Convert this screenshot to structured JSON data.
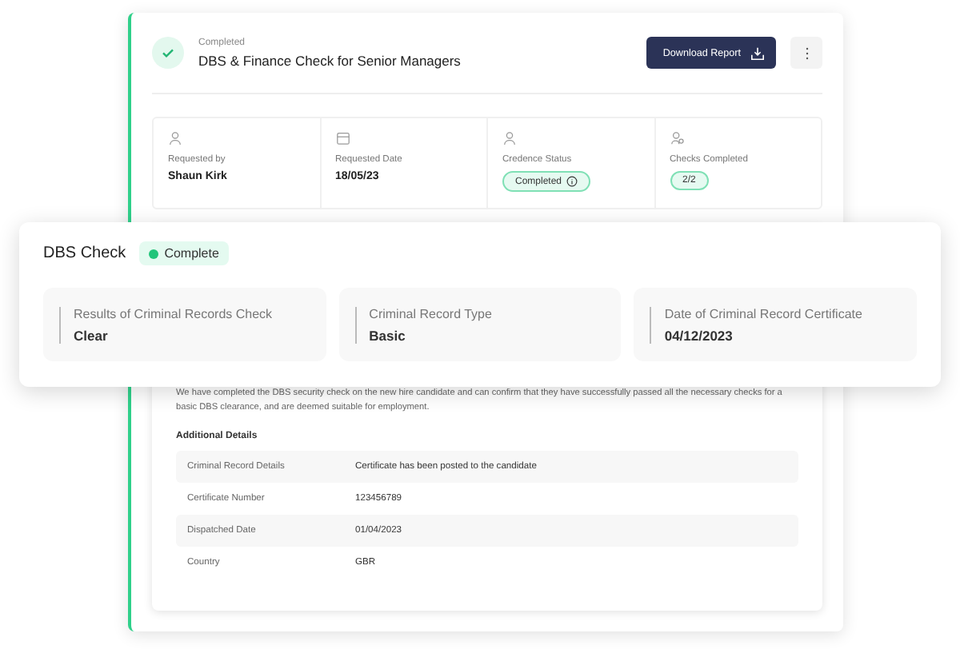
{
  "header": {
    "status": "Completed",
    "title": "DBS & Finance Check for Senior Managers",
    "download_button": "Download Report",
    "completed": true
  },
  "stats": [
    {
      "kind": "text",
      "label": "Requested by",
      "value": "Shaun Kirk"
    },
    {
      "kind": "text",
      "label": "Requested Date",
      "value": "18/05/23"
    },
    {
      "kind": "pill",
      "label": "Credence Status",
      "value": "Completed",
      "info": true
    },
    {
      "kind": "pill",
      "label": "Checks Completed",
      "value": "2/2",
      "info": false
    }
  ],
  "dbs_check": {
    "title": "DBS Check",
    "status": "Complete",
    "fields": [
      {
        "label": "Results of Criminal Records Check",
        "value": "Clear"
      },
      {
        "label": "Criminal Record Type",
        "value": "Basic"
      },
      {
        "label": "Date of Criminal Record Certificate",
        "value": "04/12/2023"
      }
    ]
  },
  "summary": "We have completed the DBS security check on the new hire candidate and can confirm that they have successfully passed all the necessary checks for a basic DBS clearance, and are deemed suitable for employment.",
  "additional_details": {
    "title": "Additional Details",
    "rows": [
      {
        "label": "Criminal Record Details",
        "value": "Certificate has been posted to the candidate"
      },
      {
        "label": "Certificate Number",
        "value": "123456789"
      },
      {
        "label": "Dispatched Date",
        "value": "01/04/2023"
      },
      {
        "label": "Country",
        "value": "GBR"
      }
    ]
  }
}
